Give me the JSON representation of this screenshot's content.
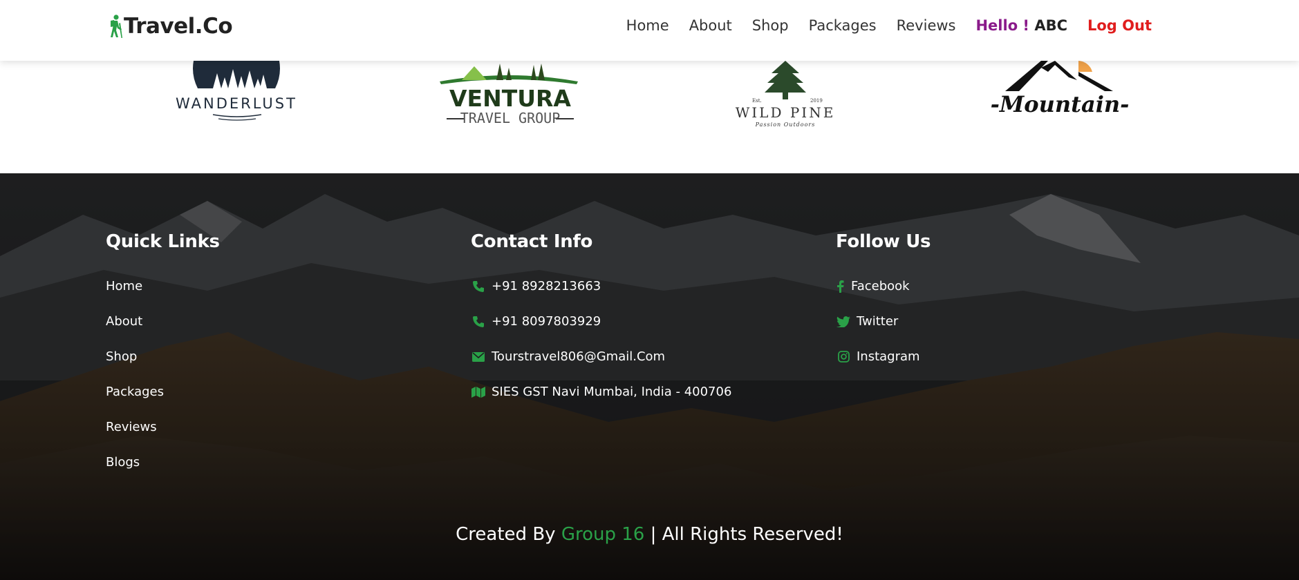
{
  "header": {
    "logo_text": "Travel.Co",
    "logo_icon": "hiker-icon",
    "nav": [
      "Home",
      "About",
      "Shop",
      "Packages",
      "Reviews"
    ],
    "greeting": "Hello !",
    "username": "ABC",
    "logout": "Log Out"
  },
  "brands": [
    {
      "name": "WANDERLUST"
    },
    {
      "name": "VENTURA",
      "tagline": "TRAVEL GROUP"
    },
    {
      "name": "WILD PINE",
      "est": "Est.",
      "year": "2019",
      "tagline": "Passion Outdoors"
    },
    {
      "name": "-Mountain-"
    }
  ],
  "footer": {
    "quick_links": {
      "title": "Quick Links",
      "items": [
        "Home",
        "About",
        "Shop",
        "Packages",
        "Reviews",
        "Blogs"
      ]
    },
    "contact": {
      "title": "Contact Info",
      "items": [
        {
          "icon": "phone-icon",
          "text": "+91 8928213663"
        },
        {
          "icon": "phone-icon",
          "text": "+91 8097803929"
        },
        {
          "icon": "envelope-icon",
          "text": "Tourstravel806@Gmail.Com"
        },
        {
          "icon": "map-icon",
          "text": "SIES GST Navi Mumbai, India - 400706"
        }
      ]
    },
    "follow": {
      "title": "Follow Us",
      "items": [
        {
          "icon": "facebook-icon",
          "text": "Facebook"
        },
        {
          "icon": "twitter-icon",
          "text": "Twitter"
        },
        {
          "icon": "instagram-icon",
          "text": "Instagram"
        }
      ]
    },
    "credit_prefix": "Created By",
    "credit_group": "Group 16",
    "credit_suffix": "| All Rights Reserved!"
  },
  "colors": {
    "accent_green": "#2aa148",
    "greeting_purple": "#8a1a8a",
    "logout_red": "#e01d1d"
  }
}
